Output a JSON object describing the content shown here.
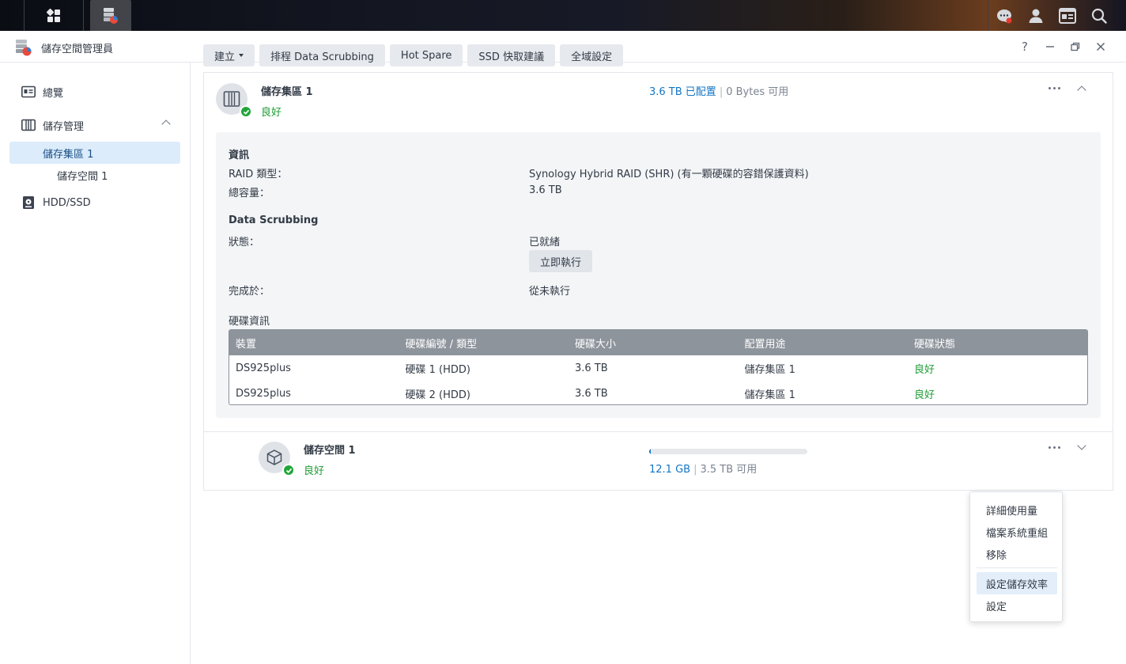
{
  "window": {
    "title": "儲存空間管理員"
  },
  "sidebar": {
    "items": [
      {
        "label": "總覽"
      },
      {
        "label": "儲存管理"
      },
      {
        "label": "儲存集區 1"
      },
      {
        "label": "儲存空間 1"
      },
      {
        "label": "HDD/SSD"
      }
    ]
  },
  "toolbar": {
    "create": "建立",
    "scrubbing": "排程 Data Scrubbing",
    "hotspare": "Hot Spare",
    "ssd": "SSD 快取建議",
    "global": "全域設定"
  },
  "pool": {
    "name": "儲存集區 1",
    "status": "良好",
    "allocated": "3.6 TB 已配置",
    "available": "0 Bytes 可用",
    "info_heading": "資訊",
    "raid_label": "RAID 類型：",
    "raid_value": "Synology Hybrid RAID (SHR) (有一顆硬碟的容錯保護資料)",
    "capacity_label": "總容量：",
    "capacity_value": "3.6 TB",
    "scrub_heading": "Data Scrubbing",
    "state_label": "狀態：",
    "state_value": "已就緒",
    "run_now": "立即執行",
    "finished_label": "完成於：",
    "finished_value": "從未執行",
    "disk_heading": "硬碟資訊",
    "disk_columns": [
      "裝置",
      "硬碟編號 / 類型",
      "硬碟大小",
      "配置用途",
      "硬碟狀態"
    ],
    "disks": [
      [
        "DS925plus",
        "硬碟 1 (HDD)",
        "3.6 TB",
        "儲存集區 1",
        "良好"
      ],
      [
        "DS925plus",
        "硬碟 2 (HDD)",
        "3.6 TB",
        "儲存集區 1",
        "良好"
      ]
    ]
  },
  "volume": {
    "name": "儲存空間 1",
    "status": "良好",
    "used": "12.1 GB",
    "available": "3.5 TB 可用",
    "usage_fraction": 0.003
  },
  "context_menu": {
    "items": [
      "詳細使用量",
      "檔案系統重組",
      "移除",
      "設定儲存效率",
      "設定"
    ]
  },
  "colors": {
    "accent": "#1475c4",
    "ok": "#1f9d35",
    "selected": "#dcecfb"
  }
}
